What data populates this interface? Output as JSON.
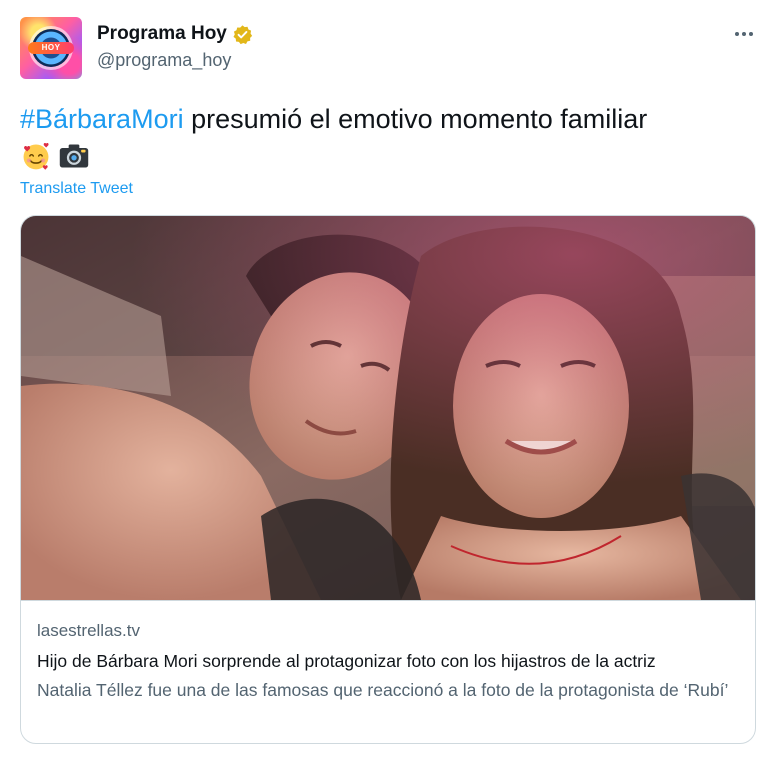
{
  "author": {
    "display_name": "Programa Hoy",
    "handle": "@programa_hoy",
    "verified": true
  },
  "tweet": {
    "hashtag": "#BárbaraMori",
    "text": " presumió el emotivo momento familiar",
    "emojis": [
      "smiling-face-with-hearts-icon",
      "camera-with-flash-icon"
    ],
    "translate_label": "Translate Tweet"
  },
  "card": {
    "domain": "lasestrellas.tv",
    "title": "Hijo de Bárbara Mori sorprende al protagonizar foto con los hijastros de la actriz",
    "description": "Natalia Téllez fue una de las famosas que reaccionó a la foto de la protagonista de ‘Rubí’"
  },
  "colors": {
    "link": "#1d9bf0",
    "secondary_text": "#536471",
    "primary_text": "#0f1419",
    "verified_badge": "#e2b719",
    "border": "#cfd9de"
  }
}
